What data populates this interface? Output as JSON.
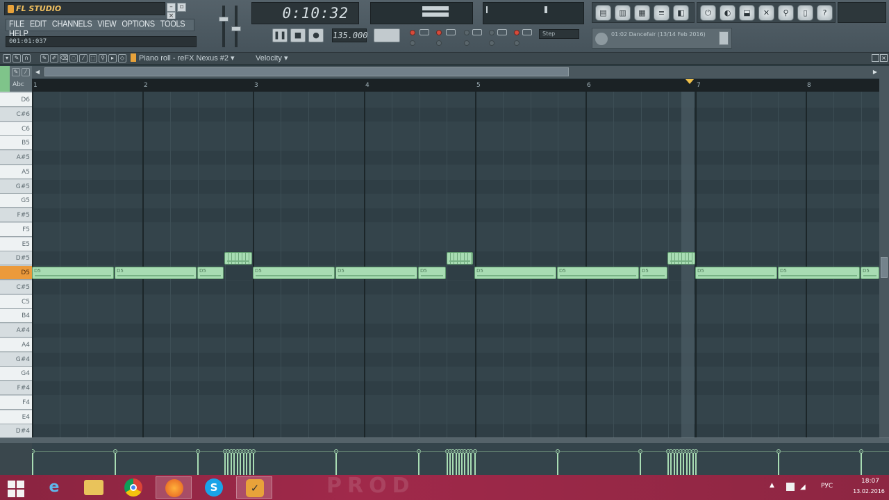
{
  "app": {
    "name": "FL STUDIO"
  },
  "menu": [
    "FILE",
    "EDIT",
    "CHANNELS",
    "VIEW",
    "OPTIONS",
    "TOOLS",
    "HELP"
  ],
  "song_position": "001:01:037",
  "time_display": "0:10:32",
  "tempo": "135.000",
  "snap": "Step",
  "hint_bar": {
    "text": "01:02 Dancefair (13/14 Feb 2016)"
  },
  "piano_roll": {
    "title": "Piano roll - reFX Nexus #2",
    "target": "Velocity",
    "tool_letter": "Abc"
  },
  "ruler": {
    "bars": [
      "1",
      "2",
      "3",
      "4",
      "5",
      "6",
      "7",
      "8"
    ]
  },
  "keys": [
    {
      "label": "D6",
      "type": "white"
    },
    {
      "label": "C#6",
      "type": "black"
    },
    {
      "label": "C6",
      "type": "white"
    },
    {
      "label": "B5",
      "type": "white"
    },
    {
      "label": "A#5",
      "type": "black"
    },
    {
      "label": "A5",
      "type": "white"
    },
    {
      "label": "G#5",
      "type": "black"
    },
    {
      "label": "G5",
      "type": "white"
    },
    {
      "label": "F#5",
      "type": "black"
    },
    {
      "label": "F5",
      "type": "white"
    },
    {
      "label": "E5",
      "type": "white"
    },
    {
      "label": "D#5",
      "type": "black"
    },
    {
      "label": "D5",
      "type": "active"
    },
    {
      "label": "C#5",
      "type": "black"
    },
    {
      "label": "C5",
      "type": "white"
    },
    {
      "label": "B4",
      "type": "white"
    },
    {
      "label": "A#4",
      "type": "black"
    },
    {
      "label": "A4",
      "type": "white"
    },
    {
      "label": "G#4",
      "type": "black"
    },
    {
      "label": "G4",
      "type": "white"
    },
    {
      "label": "F#4",
      "type": "black"
    },
    {
      "label": "F4",
      "type": "white"
    },
    {
      "label": "E4",
      "type": "white"
    },
    {
      "label": "D#4",
      "type": "black"
    }
  ],
  "notes_label": "D5",
  "taskbar": {
    "tray_lang": "РУС",
    "clock_time": "18:07",
    "clock_date": "13.02.2016",
    "watermark": "PROD"
  }
}
